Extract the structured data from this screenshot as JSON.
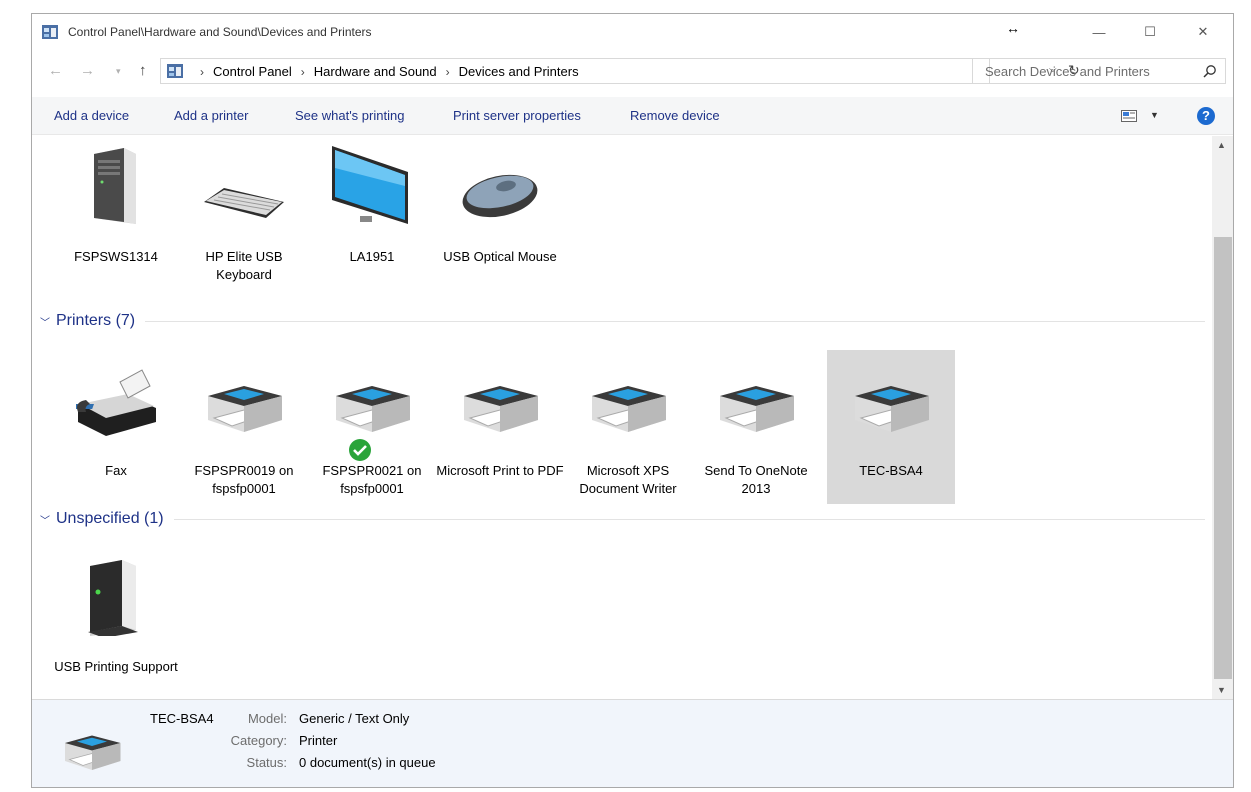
{
  "window": {
    "title": "Control Panel\\Hardware and Sound\\Devices and Printers",
    "resize_glyph": "↔",
    "controls": {
      "minimize": "—",
      "maximize": "☐",
      "close": "✕"
    }
  },
  "address": {
    "breadcrumbs": [
      "Control Panel",
      "Hardware and Sound",
      "Devices and Printers"
    ],
    "search_placeholder": "Search Devices and Printers"
  },
  "toolbar": {
    "commands": [
      "Add a device",
      "Add a printer",
      "See what's printing",
      "Print server properties",
      "Remove device"
    ]
  },
  "groups": {
    "devices": {
      "items": [
        {
          "label": "FSPSWS1314",
          "icon": "computer-tower-icon"
        },
        {
          "label": "HP Elite USB Keyboard",
          "icon": "keyboard-icon"
        },
        {
          "label": "LA1951",
          "icon": "monitor-icon"
        },
        {
          "label": "USB Optical Mouse",
          "icon": "mouse-icon"
        }
      ]
    },
    "printers": {
      "title": "Printers (7)",
      "items": [
        {
          "label": "Fax",
          "icon": "fax-icon"
        },
        {
          "label": "FSPSPR0019 on fspsfp0001",
          "icon": "printer-icon"
        },
        {
          "label": "FSPSPR0021 on fspsfp0001",
          "icon": "printer-icon",
          "default": true
        },
        {
          "label": "Microsoft Print to PDF",
          "icon": "printer-icon"
        },
        {
          "label": "Microsoft XPS Document Writer",
          "icon": "printer-icon"
        },
        {
          "label": "Send To OneNote 2013",
          "icon": "printer-icon"
        },
        {
          "label": "TEC-BSA4",
          "icon": "printer-icon",
          "selected": true
        }
      ]
    },
    "unspecified": {
      "title": "Unspecified (1)",
      "items": [
        {
          "label": "USB Printing Support",
          "icon": "usb-device-icon"
        }
      ]
    }
  },
  "details": {
    "name": "TEC-BSA4",
    "model_label": "Model:",
    "model": "Generic / Text Only",
    "category_label": "Category:",
    "category": "Printer",
    "status_label": "Status:",
    "status": "0 document(s) in queue"
  },
  "colors": {
    "link_blue": "#1e3287",
    "selected_bg": "#d9d9d9",
    "details_bg": "#f1f5fb"
  }
}
